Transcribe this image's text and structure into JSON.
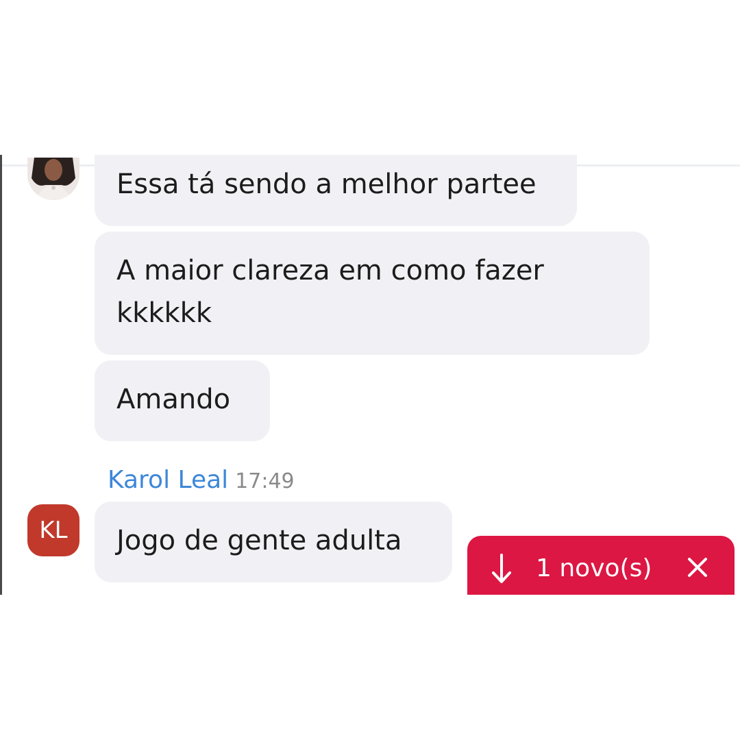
{
  "messages": [
    {
      "text": "Essa tá sendo a melhor partee"
    },
    {
      "text": "A maior clareza em como fazer kkkkkk"
    },
    {
      "text": "Amando"
    }
  ],
  "sender": {
    "name": "Karol Leal",
    "time": "17:49",
    "initials": "KL",
    "avatar_color": "#c0392b",
    "message": "Jogo de gente adulta"
  },
  "new_messages": {
    "icon": "arrow-down-icon",
    "label": "1 novo(s)",
    "close_icon": "close-icon",
    "color": "#dc1743"
  },
  "colors": {
    "bubble_bg": "#f1f1f5",
    "sender_name": "#3d87d8"
  }
}
